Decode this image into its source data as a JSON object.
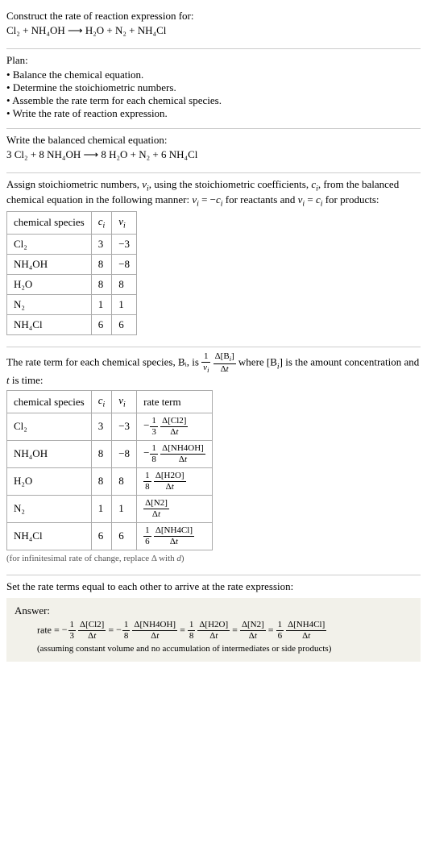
{
  "header": {
    "prompt": "Construct the rate of reaction expression for:",
    "equation": "Cl₂ + NH₄OH ⟶ H₂O + N₂ + NH₄Cl"
  },
  "plan": {
    "title": "Plan:",
    "items": [
      "Balance the chemical equation.",
      "Determine the stoichiometric numbers.",
      "Assemble the rate term for each chemical species.",
      "Write the rate of reaction expression."
    ]
  },
  "balanced": {
    "title": "Write the balanced chemical equation:",
    "equation": "3 Cl₂ + 8 NH₄OH ⟶ 8 H₂O + N₂ + 6 NH₄Cl"
  },
  "stoich": {
    "intro": "Assign stoichiometric numbers, νᵢ, using the stoichiometric coefficients, cᵢ, from the balanced chemical equation in the following manner: νᵢ = −cᵢ for reactants and νᵢ = cᵢ for products:",
    "headers": {
      "species": "chemical species",
      "ci": "cᵢ",
      "vi": "νᵢ"
    },
    "rows": [
      {
        "species": "Cl₂",
        "ci": "3",
        "vi": "−3"
      },
      {
        "species": "NH₄OH",
        "ci": "8",
        "vi": "−8"
      },
      {
        "species": "H₂O",
        "ci": "8",
        "vi": "8"
      },
      {
        "species": "N₂",
        "ci": "1",
        "vi": "1"
      },
      {
        "species": "NH₄Cl",
        "ci": "6",
        "vi": "6"
      }
    ]
  },
  "rateterm": {
    "intro_pre": "The rate term for each chemical species, Bᵢ, is ",
    "intro_post": " where [Bᵢ] is the amount concentration and t is time:",
    "headers": {
      "species": "chemical species",
      "ci": "cᵢ",
      "vi": "νᵢ",
      "rate": "rate term"
    },
    "rows": [
      {
        "species": "Cl₂",
        "ci": "3",
        "vi": "−3",
        "sign": "−",
        "coef_num": "1",
        "coef_den": "3",
        "d_num": "Δ[Cl2]",
        "d_den": "Δt"
      },
      {
        "species": "NH₄OH",
        "ci": "8",
        "vi": "−8",
        "sign": "−",
        "coef_num": "1",
        "coef_den": "8",
        "d_num": "Δ[NH4OH]",
        "d_den": "Δt"
      },
      {
        "species": "H₂O",
        "ci": "8",
        "vi": "8",
        "sign": "",
        "coef_num": "1",
        "coef_den": "8",
        "d_num": "Δ[H2O]",
        "d_den": "Δt"
      },
      {
        "species": "N₂",
        "ci": "1",
        "vi": "1",
        "sign": "",
        "coef_num": "",
        "coef_den": "",
        "d_num": "Δ[N2]",
        "d_den": "Δt"
      },
      {
        "species": "NH₄Cl",
        "ci": "6",
        "vi": "6",
        "sign": "",
        "coef_num": "1",
        "coef_den": "6",
        "d_num": "Δ[NH4Cl]",
        "d_den": "Δt"
      }
    ],
    "footnote": "(for infinitesimal rate of change, replace Δ with d)"
  },
  "setrate": {
    "title": "Set the rate terms equal to each other to arrive at the rate expression:"
  },
  "answer": {
    "label": "Answer:",
    "prefix": "rate = ",
    "terms": [
      {
        "sign": "−",
        "coef_num": "1",
        "coef_den": "3",
        "d_num": "Δ[Cl2]",
        "d_den": "Δt"
      },
      {
        "sign": "−",
        "coef_num": "1",
        "coef_den": "8",
        "d_num": "Δ[NH4OH]",
        "d_den": "Δt"
      },
      {
        "sign": "",
        "coef_num": "1",
        "coef_den": "8",
        "d_num": "Δ[H2O]",
        "d_den": "Δt"
      },
      {
        "sign": "",
        "coef_num": "",
        "coef_den": "",
        "d_num": "Δ[N2]",
        "d_den": "Δt"
      },
      {
        "sign": "",
        "coef_num": "1",
        "coef_den": "6",
        "d_num": "Δ[NH4Cl]",
        "d_den": "Δt"
      }
    ],
    "note": "(assuming constant volume and no accumulation of intermediates or side products)"
  }
}
